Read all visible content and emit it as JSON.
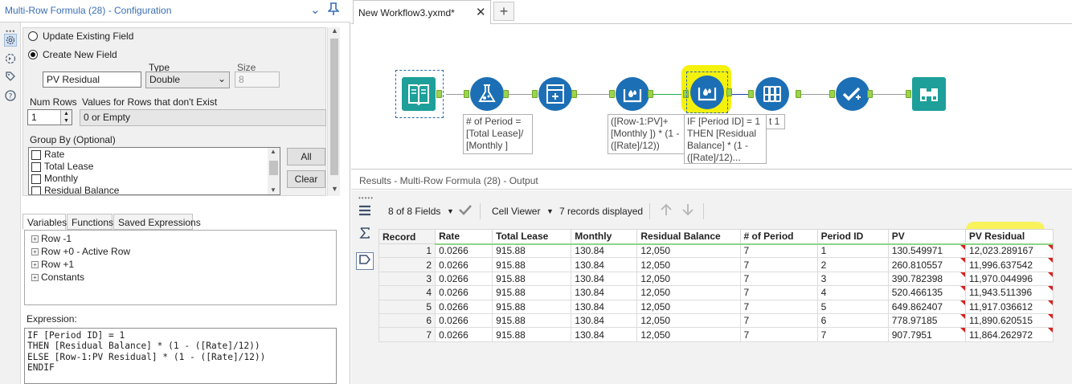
{
  "config": {
    "title": "Multi-Row Formula (28) - Configuration",
    "update_existing_label": "Update Existing Field",
    "create_new_label": "Create New  Field",
    "field_name": "PV Residual",
    "type_label": "Type",
    "type_value": "Double",
    "size_label": "Size",
    "size_value": "8",
    "num_rows_label": "Num Rows",
    "num_rows_value": "1",
    "rows_not_exist_label": "Values for Rows that don't Exist",
    "rows_not_exist_value": "0 or Empty",
    "group_by_label": "Group By (Optional)",
    "group_by_items": [
      "Rate",
      "Total Lease",
      "Monthly",
      "Residual Balance"
    ],
    "all_button": "All",
    "clear_button": "Clear",
    "tabs": [
      "Variables",
      "Functions",
      "Saved Expressions"
    ],
    "tree_items": [
      "Row -1",
      "Row +0 - Active Row",
      "Row +1",
      "Constants"
    ],
    "expression_label": "Expression:",
    "expression_lines": [
      "IF [Period ID] = 1",
      "THEN [Residual Balance] * (1 - ([Rate]/12))",
      "ELSE [Row-1:PV Residual] * (1 - ([Rate]/12))",
      "ENDIF"
    ]
  },
  "workflow": {
    "tab_title": "New Workflow3.yxmd*",
    "tab_close": "✕",
    "add_tab": "+",
    "annotations": {
      "formula1": "# of Period =\n[Total Lease]/\n[Monthly ]",
      "formula2": "([Row-1:PV]+\n[Monthly ]) * (1 -\n([Rate]/12))",
      "formula3": "IF [Period ID] = 1\nTHEN [Residual\nBalance] * (1 -\n([Rate]/12)...",
      "formula3_tail": "t 1"
    },
    "colors": {
      "teal": "#1e9f9a",
      "blue": "#1c6fb5",
      "highlight": "#f4f10d"
    }
  },
  "results": {
    "title": "Results - Multi-Row Formula (28) - Output",
    "fields_label": "8 of 8 Fields",
    "cell_viewer_label": "Cell Viewer",
    "records_label": "7 records displayed",
    "columns": [
      "Record",
      "Rate",
      "Total Lease",
      "Monthly",
      "Residual Balance",
      "# of Period",
      "Period ID",
      "PV",
      "PV Residual"
    ],
    "rows": [
      [
        "1",
        "0.0266",
        "915.88",
        "130.84",
        "12,050",
        "7",
        "1",
        "130.549971",
        "12,023.289167"
      ],
      [
        "2",
        "0.0266",
        "915.88",
        "130.84",
        "12,050",
        "7",
        "2",
        "260.810557",
        "11,996.637542"
      ],
      [
        "3",
        "0.0266",
        "915.88",
        "130.84",
        "12,050",
        "7",
        "3",
        "390.782398",
        "11,970.044996"
      ],
      [
        "4",
        "0.0266",
        "915.88",
        "130.84",
        "12,050",
        "7",
        "4",
        "520.466135",
        "11,943.511396"
      ],
      [
        "5",
        "0.0266",
        "915.88",
        "130.84",
        "12,050",
        "7",
        "5",
        "649.862407",
        "11,917.036612"
      ],
      [
        "6",
        "0.0266",
        "915.88",
        "130.84",
        "12,050",
        "7",
        "6",
        "778.97185",
        "11,890.620515"
      ],
      [
        "7",
        "0.0266",
        "915.88",
        "130.84",
        "12,050",
        "7",
        "7",
        "907.7951",
        "11,864.262972"
      ]
    ]
  }
}
